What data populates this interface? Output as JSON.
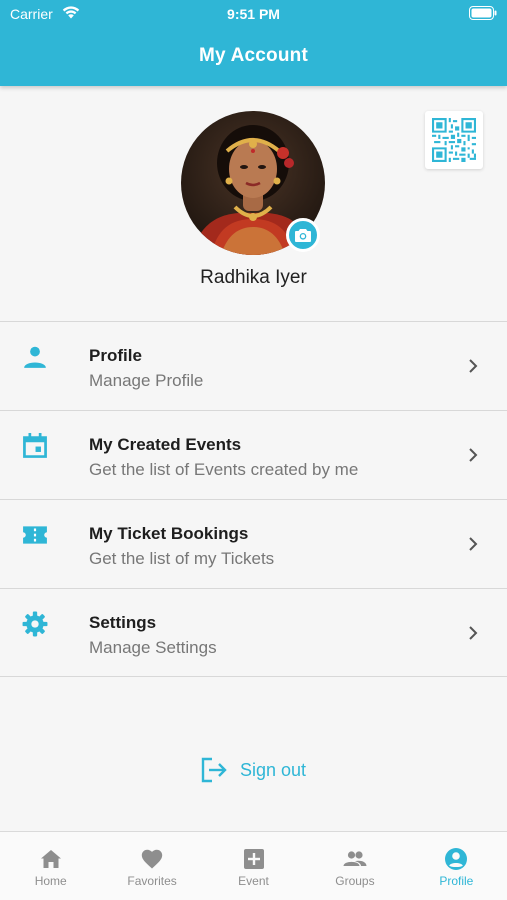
{
  "status_bar": {
    "carrier": "Carrier",
    "time": "9:51 PM"
  },
  "header": {
    "title": "My Account"
  },
  "profile": {
    "name": "Radhika Iyer"
  },
  "menu": [
    {
      "title": "Profile",
      "subtitle": "Manage Profile",
      "icon": "person-icon"
    },
    {
      "title": "My Created Events",
      "subtitle": "Get the list of Events created by me",
      "icon": "calendar-icon"
    },
    {
      "title": "My Ticket Bookings",
      "subtitle": "Get the list of my Tickets",
      "icon": "ticket-icon"
    },
    {
      "title": "Settings",
      "subtitle": "Manage Settings",
      "icon": "gear-icon"
    }
  ],
  "signout": {
    "label": "Sign out"
  },
  "tabs": [
    {
      "label": "Home",
      "icon": "home-icon"
    },
    {
      "label": "Favorites",
      "icon": "heart-icon"
    },
    {
      "label": "Event",
      "icon": "add-box-icon"
    },
    {
      "label": "Groups",
      "icon": "group-icon"
    },
    {
      "label": "Profile",
      "icon": "account-circle-icon",
      "active": true
    }
  ],
  "colors": {
    "accent": "#2fb6d6",
    "inactive": "#8e8e8e"
  }
}
